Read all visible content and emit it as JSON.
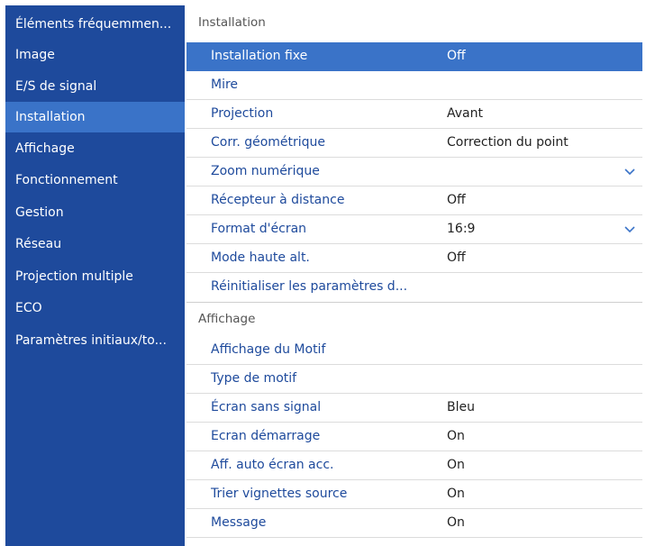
{
  "sidebar": {
    "items": [
      {
        "label": "Éléments fréquemmen..."
      },
      {
        "label": "Image"
      },
      {
        "label": "E/S de signal"
      },
      {
        "label": "Installation"
      },
      {
        "label": "Affichage"
      },
      {
        "label": "Fonctionnement"
      },
      {
        "label": "Gestion"
      },
      {
        "label": "Réseau"
      },
      {
        "label": "Projection multiple"
      },
      {
        "label": "ECO"
      },
      {
        "label": "Paramètres initiaux/to..."
      }
    ],
    "selected": "Installation"
  },
  "sections": [
    {
      "title": "Installation",
      "rows": [
        {
          "label": "Installation fixe",
          "value": "Off",
          "selected": true
        },
        {
          "label": "Mire",
          "value": ""
        },
        {
          "label": "Projection",
          "value": "Avant"
        },
        {
          "label": "Corr. géométrique",
          "value": "Correction du point"
        },
        {
          "label": "Zoom numérique",
          "value": "",
          "icon": "chevron-down-icon"
        },
        {
          "label": "Récepteur à distance",
          "value": "Off"
        },
        {
          "label": "Format d'écran",
          "value": "16:9",
          "icon": "chevron-down-icon"
        },
        {
          "label": "Mode haute alt.",
          "value": "Off"
        },
        {
          "label": "Réinitialiser les paramètres d...",
          "value": ""
        }
      ]
    },
    {
      "title": "Affichage",
      "rows": [
        {
          "label": "Affichage du Motif",
          "value": ""
        },
        {
          "label": "Type de motif",
          "value": ""
        },
        {
          "label": "Écran sans signal",
          "value": "Bleu"
        },
        {
          "label": "Ecran démarrage",
          "value": "On"
        },
        {
          "label": "Aff. auto écran acc.",
          "value": "On"
        },
        {
          "label": "Trier vignettes source",
          "value": "On"
        },
        {
          "label": "Message",
          "value": "On"
        }
      ]
    }
  ],
  "colors": {
    "sidebar_bg": "#1e4a9c",
    "highlight": "#3a73c8",
    "label_text": "#1e4a9c",
    "value_text": "#222222"
  }
}
